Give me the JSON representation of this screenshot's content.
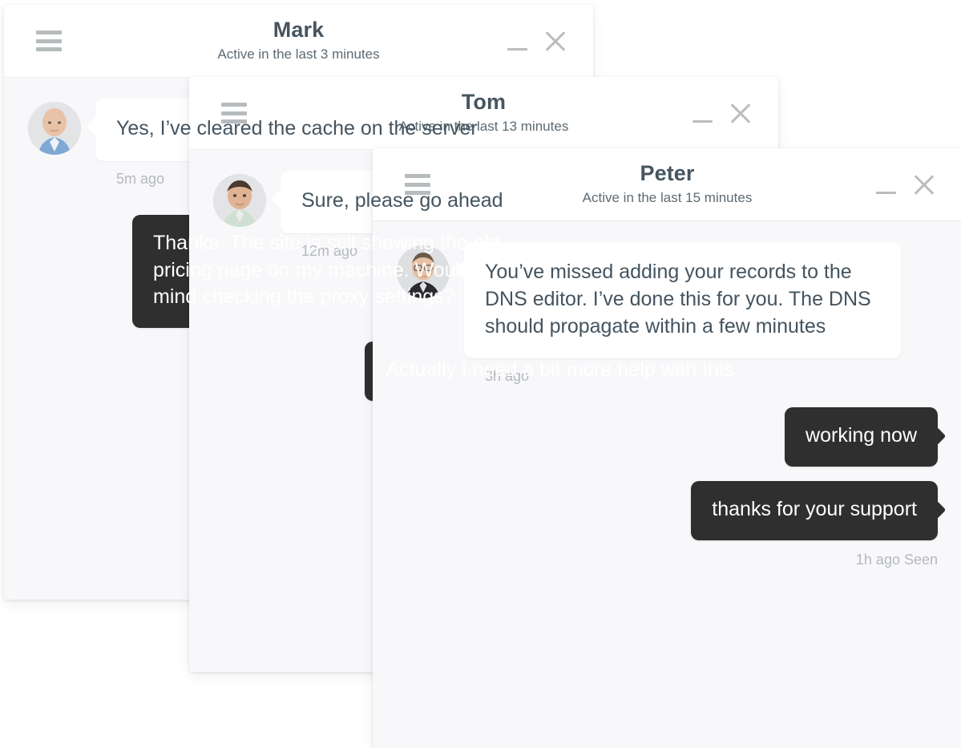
{
  "theme": {
    "window_background": "#f8f8fb",
    "header_background": "#ffffff",
    "incoming_bubble": "#ffffff",
    "outgoing_bubble": "#2f2f2f",
    "title_color": "#455560",
    "timestamp_color": "#b4b9bc",
    "icon_color": "#b9bdbf"
  },
  "windows": [
    {
      "id": "mark",
      "header": {
        "name": "Mark",
        "status": "Active in the last 3 minutes",
        "menu_icon": "hamburger-icon",
        "minimize_icon": "minimize-icon",
        "close_icon": "close-icon"
      },
      "messages": [
        {
          "direction": "incoming",
          "text": "Yes, I’ve cleared the cache on the server",
          "timestamp": "5m ago",
          "avatar": "mark-avatar"
        },
        {
          "direction": "outgoing",
          "text": "Thanks. The site is still showing the old pricing page on my machine. Would you mind checking the proxy settings?",
          "timestamp": ""
        }
      ]
    },
    {
      "id": "tom",
      "header": {
        "name": "Tom",
        "status": "Active in the last 13 minutes",
        "menu_icon": "hamburger-icon",
        "minimize_icon": "minimize-icon",
        "close_icon": "close-icon"
      },
      "messages": [
        {
          "direction": "incoming",
          "text": "Sure, please go ahead",
          "timestamp": "12m ago",
          "avatar": "tom-avatar"
        },
        {
          "direction": "outgoing",
          "text": "Actually I need a bit more help with this",
          "timestamp": ""
        }
      ]
    },
    {
      "id": "peter",
      "header": {
        "name": "Peter",
        "status": "Active in the last 15 minutes",
        "menu_icon": "hamburger-icon",
        "minimize_icon": "minimize-icon",
        "close_icon": "close-icon"
      },
      "messages": [
        {
          "direction": "incoming",
          "text": "You’ve missed adding your records to the DNS editor. I’ve done this for you. The DNS should propagate within a few minutes",
          "timestamp": "3h ago",
          "avatar": "peter-avatar"
        },
        {
          "direction": "outgoing",
          "text": "working now",
          "timestamp": ""
        },
        {
          "direction": "outgoing",
          "text": "thanks for your support",
          "timestamp": "1h ago Seen"
        }
      ]
    }
  ]
}
